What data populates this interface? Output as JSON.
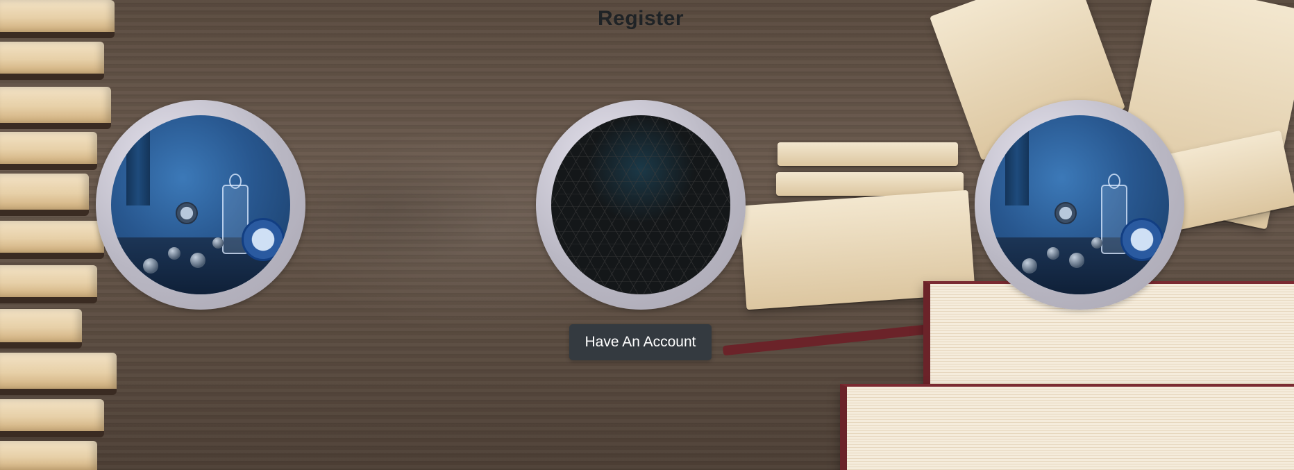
{
  "page": {
    "title": "Register"
  },
  "profile_images": [
    {
      "name": "blue-still-life",
      "description": "Blue still life with clocks and jar"
    },
    {
      "name": "hexagon-pattern",
      "description": "Dark hexagon tech pattern"
    },
    {
      "name": "blue-still-life",
      "description": "Blue still life with clocks and jar"
    }
  ],
  "actions": {
    "have_account_label": "Have An Account"
  },
  "colors": {
    "button_bg": "#343a40",
    "button_text": "#ffffff",
    "title_text": "#1f2326",
    "ring": "#b9b7c3"
  }
}
